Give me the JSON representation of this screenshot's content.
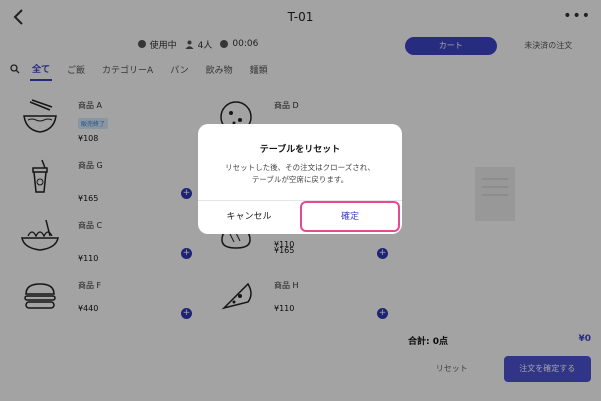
{
  "header": {
    "title": "T-01",
    "more": "•••"
  },
  "status": {
    "state": "使用中",
    "guests": "4人",
    "time": "00:06"
  },
  "tabs": [
    "全て",
    "ご飯",
    "カテゴリーA",
    "パン",
    "飲み物",
    "麺類"
  ],
  "products": [
    {
      "name": "商品 A",
      "price": "¥108",
      "badge": "販売終了",
      "icon": "ramen-bowl-icon"
    },
    {
      "name": "商品 D",
      "price": "",
      "badge": "",
      "icon": "pizza-icon"
    },
    {
      "name": "商品 G",
      "price": "¥165",
      "badge": "",
      "icon": "drink-cup-icon"
    },
    {
      "name": "商品 C",
      "price": "¥110",
      "badge": "",
      "icon": "pasta-icon"
    },
    {
      "name": "",
      "price": "¥165",
      "badge": "",
      "icon": "bread-icon"
    },
    {
      "name": "商品 F",
      "price": "¥440",
      "badge": "",
      "icon": "burger-icon"
    },
    {
      "name": "商品 H",
      "price": "¥110",
      "badge": "",
      "icon": "pizza-slice-icon"
    },
    {
      "name": "",
      "price": "¥110",
      "badge": "",
      "icon": ""
    }
  ],
  "right_panel": {
    "tabs": [
      "カート",
      "未決済の注文"
    ],
    "total_label": "合計: 0点",
    "total_amount": "¥0",
    "reset": "リセット",
    "confirm_order": "注文を確定する"
  },
  "dialog": {
    "title": "テーブルをリセット",
    "message_line1": "リセットした後、その注文はクローズされ、",
    "message_line2": "テーブルが空席に戻ります。",
    "cancel": "キャンセル",
    "confirm": "確定"
  },
  "colors": {
    "accent": "#3b42c7",
    "highlight": "#e44a8f",
    "overlay": "rgba(0,0,0,0.36)"
  }
}
